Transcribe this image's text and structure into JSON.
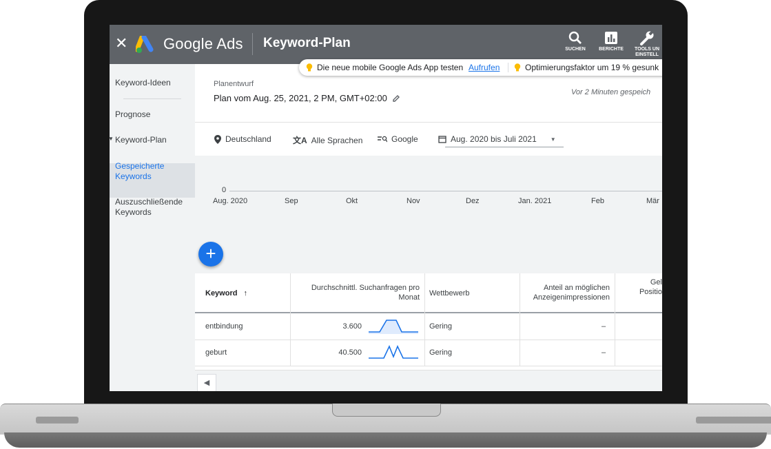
{
  "header": {
    "close_glyph": "✕",
    "brand": "Google Ads",
    "title": "Keyword-Plan",
    "tools": [
      {
        "label": "SUCHEN",
        "icon": "search-icon"
      },
      {
        "label": "BERICHTE",
        "icon": "bar-chart-icon"
      },
      {
        "label": "TOOLS UN",
        "label2": "EINSTELL",
        "icon": "wrench-icon"
      }
    ]
  },
  "banner": {
    "text1": "Die neue mobile Google Ads App testen",
    "link": "Aufrufen",
    "text2": "Optimierungsfaktor um 19 % gesunk"
  },
  "sidebar": {
    "items": [
      {
        "label": "Keyword-Ideen"
      },
      {
        "label": "Prognose"
      },
      {
        "label": "Keyword-Plan"
      },
      {
        "label": "Gespeicherte",
        "label2": "Keywords"
      },
      {
        "label": "Auszuschließende",
        "label2": "Keywords"
      }
    ]
  },
  "plan": {
    "caption": "Planentwurf",
    "name": "Plan vom Aug. 25, 2021, 2 PM, GMT+02:00",
    "saved": "Vor 2 Minuten gespeich"
  },
  "filters": {
    "location": "Deutschland",
    "language": "Alle Sprachen",
    "network": "Google",
    "daterange": "Aug. 2020 bis Juli 2021"
  },
  "chart": {
    "zero": "0",
    "months": [
      "Aug. 2020",
      "Sep",
      "Okt",
      "Nov",
      "Dez",
      "Jan. 2021",
      "Feb",
      "Mär"
    ]
  },
  "fab_glyph": "+",
  "table": {
    "headers": {
      "keyword": "Keyword",
      "searches1": "Durchschnittl. Suchanfragen pro",
      "searches2": "Monat",
      "competition": "Wettbewerb",
      "impr1": "Anteil an möglichen",
      "impr2": "Anzeigenimpressionen",
      "pos1": "Gel",
      "pos2": "Positio"
    },
    "rows": [
      {
        "keyword": "entbindung",
        "searches": "3.600",
        "competition": "Gering",
        "impr": "–"
      },
      {
        "keyword": "geburt",
        "searches": "40.500",
        "competition": "Gering",
        "impr": "–"
      }
    ]
  },
  "pager_glyph": "◀",
  "colors": {
    "accent": "#1a73e8",
    "header": "#5f6368",
    "bulb": "#fbbc04"
  }
}
